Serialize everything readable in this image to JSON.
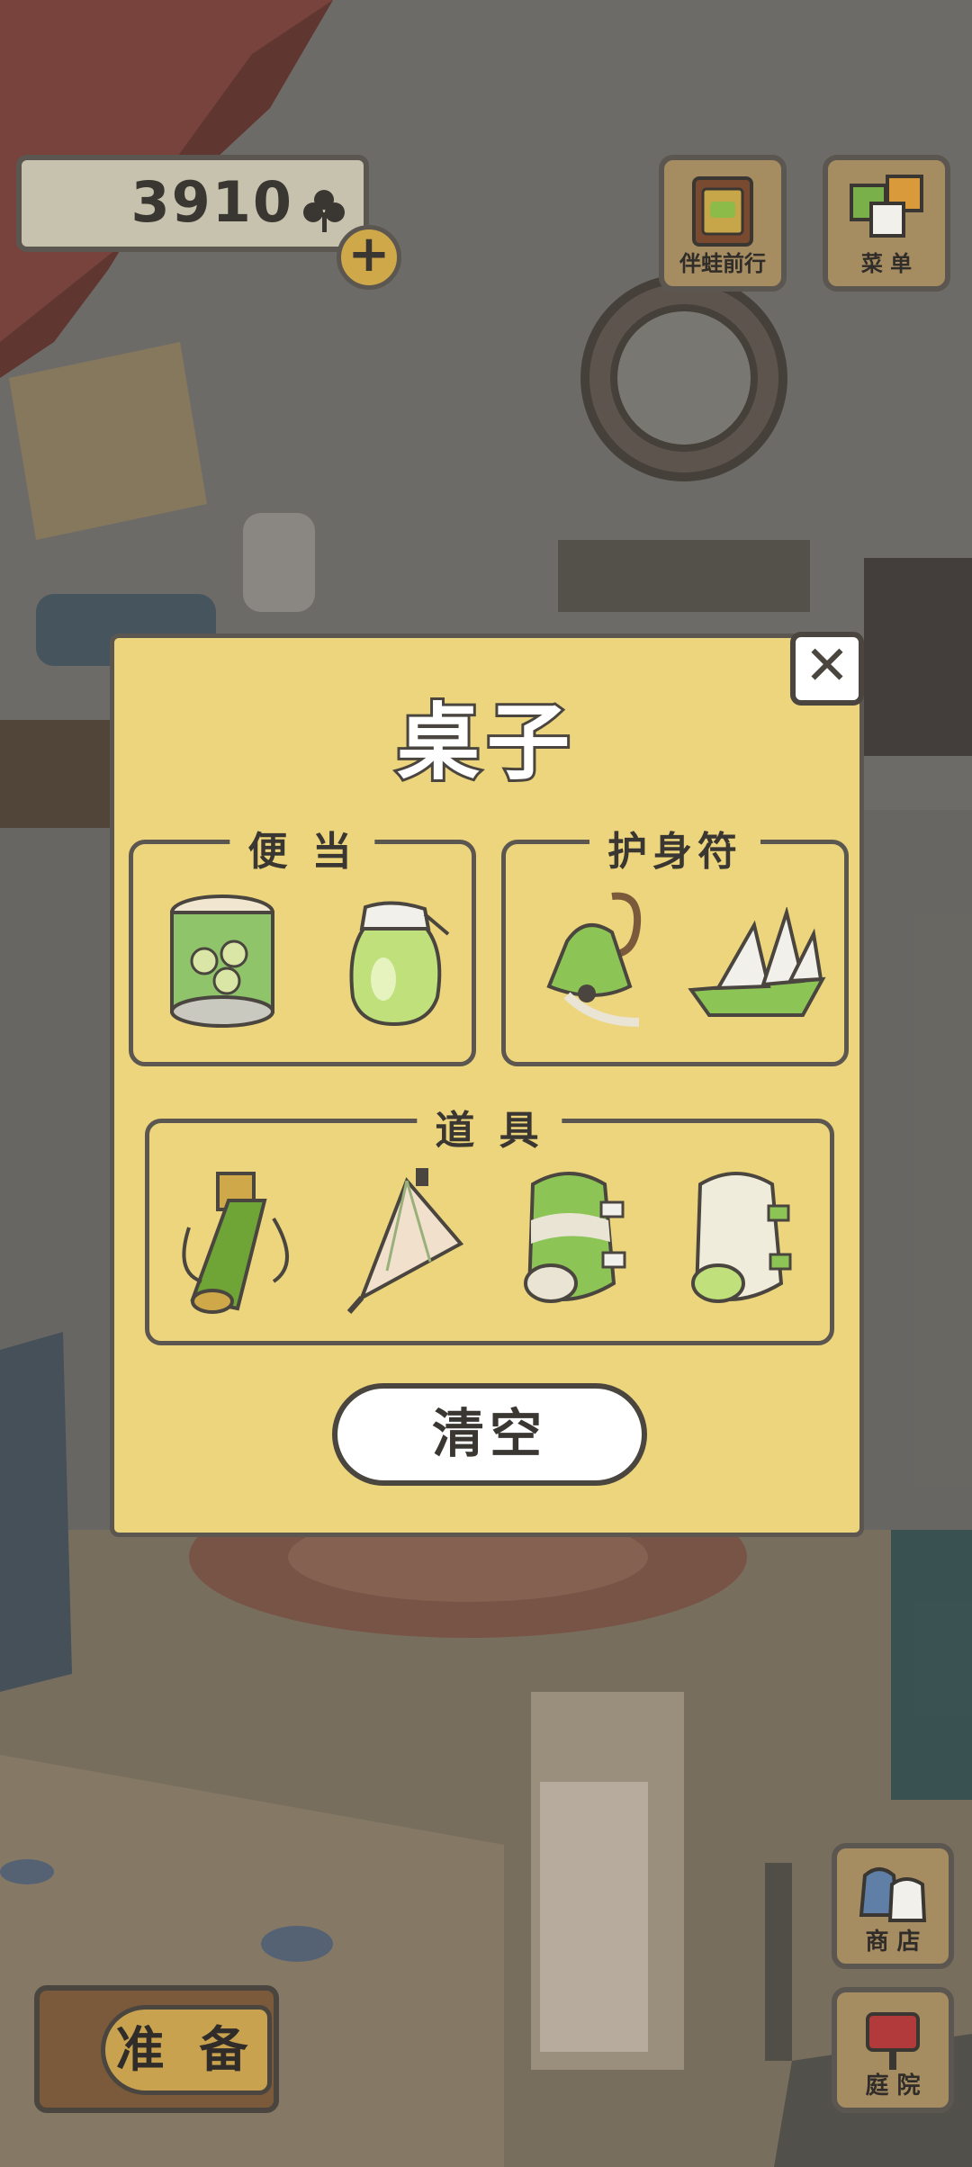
{
  "currency": {
    "amount": "3910",
    "icon": "clover-icon"
  },
  "top_buttons": [
    {
      "label": "伴蛙前行",
      "icon": "book-icon"
    },
    {
      "label": "菜 单",
      "icon": "menu-cards-icon"
    }
  ],
  "modal": {
    "title": "桌子",
    "groups": {
      "bento": {
        "title": "便 当",
        "items": [
          "canned-food-icon",
          "jar-drink-icon"
        ]
      },
      "amulet": {
        "title": "护身符",
        "items": [
          "bell-charm-icon",
          "paper-boat-icon"
        ]
      },
      "tools": {
        "title": "道 具",
        "items": [
          "bamboo-flask-icon",
          "paper-umbrella-icon",
          "green-bedroll-icon",
          "white-bedroll-icon"
        ]
      }
    },
    "clear_label": "清空",
    "close_label": "✕"
  },
  "bottom": {
    "ready_label": "准 备",
    "shop_label": "商 店",
    "garden_label": "庭 院"
  },
  "colors": {
    "modal_bg": "#ecd57c",
    "outline": "#5b5750",
    "button_wood": "#a68c61"
  }
}
